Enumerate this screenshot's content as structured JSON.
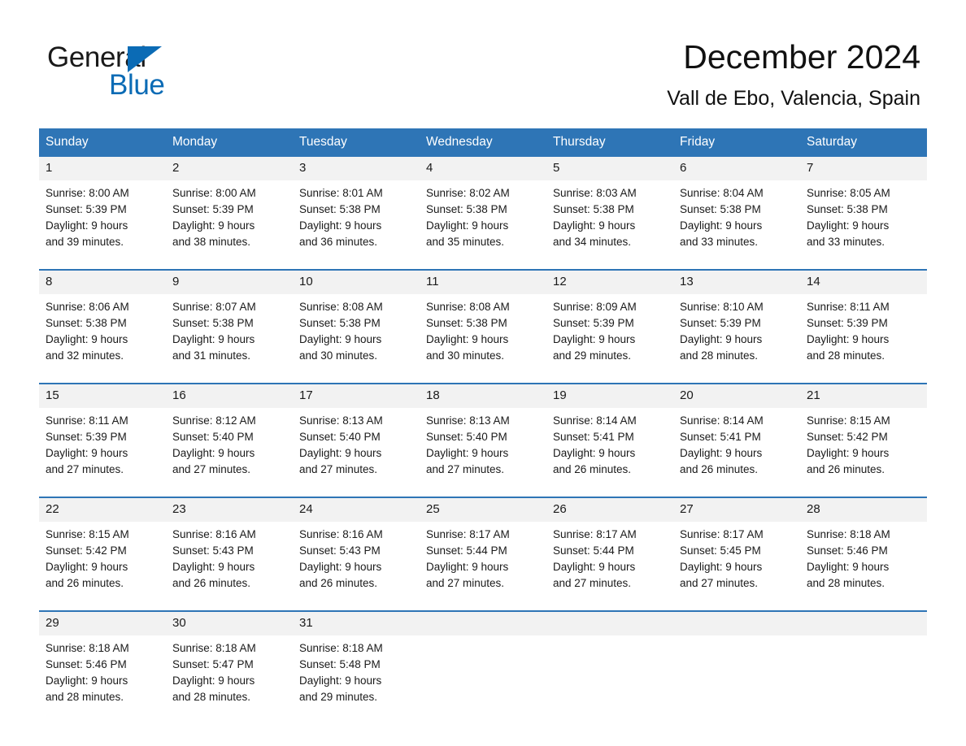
{
  "brand": {
    "name_part1": "General",
    "name_part2": "Blue",
    "accent_color": "#0b6bb5"
  },
  "header": {
    "month_title": "December 2024",
    "location": "Vall de Ebo, Valencia, Spain"
  },
  "theme": {
    "header_blue": "#2e75b6",
    "day_band_gray": "#f2f2f2",
    "text_color": "#1a1a1a"
  },
  "calendar": {
    "weekday_headers": [
      "Sunday",
      "Monday",
      "Tuesday",
      "Wednesday",
      "Thursday",
      "Friday",
      "Saturday"
    ],
    "weeks": [
      [
        {
          "date": "1",
          "sunrise": "Sunrise: 8:00 AM",
          "sunset": "Sunset: 5:39 PM",
          "daylight_line1": "Daylight: 9 hours",
          "daylight_line2": "and 39 minutes."
        },
        {
          "date": "2",
          "sunrise": "Sunrise: 8:00 AM",
          "sunset": "Sunset: 5:39 PM",
          "daylight_line1": "Daylight: 9 hours",
          "daylight_line2": "and 38 minutes."
        },
        {
          "date": "3",
          "sunrise": "Sunrise: 8:01 AM",
          "sunset": "Sunset: 5:38 PM",
          "daylight_line1": "Daylight: 9 hours",
          "daylight_line2": "and 36 minutes."
        },
        {
          "date": "4",
          "sunrise": "Sunrise: 8:02 AM",
          "sunset": "Sunset: 5:38 PM",
          "daylight_line1": "Daylight: 9 hours",
          "daylight_line2": "and 35 minutes."
        },
        {
          "date": "5",
          "sunrise": "Sunrise: 8:03 AM",
          "sunset": "Sunset: 5:38 PM",
          "daylight_line1": "Daylight: 9 hours",
          "daylight_line2": "and 34 minutes."
        },
        {
          "date": "6",
          "sunrise": "Sunrise: 8:04 AM",
          "sunset": "Sunset: 5:38 PM",
          "daylight_line1": "Daylight: 9 hours",
          "daylight_line2": "and 33 minutes."
        },
        {
          "date": "7",
          "sunrise": "Sunrise: 8:05 AM",
          "sunset": "Sunset: 5:38 PM",
          "daylight_line1": "Daylight: 9 hours",
          "daylight_line2": "and 33 minutes."
        }
      ],
      [
        {
          "date": "8",
          "sunrise": "Sunrise: 8:06 AM",
          "sunset": "Sunset: 5:38 PM",
          "daylight_line1": "Daylight: 9 hours",
          "daylight_line2": "and 32 minutes."
        },
        {
          "date": "9",
          "sunrise": "Sunrise: 8:07 AM",
          "sunset": "Sunset: 5:38 PM",
          "daylight_line1": "Daylight: 9 hours",
          "daylight_line2": "and 31 minutes."
        },
        {
          "date": "10",
          "sunrise": "Sunrise: 8:08 AM",
          "sunset": "Sunset: 5:38 PM",
          "daylight_line1": "Daylight: 9 hours",
          "daylight_line2": "and 30 minutes."
        },
        {
          "date": "11",
          "sunrise": "Sunrise: 8:08 AM",
          "sunset": "Sunset: 5:38 PM",
          "daylight_line1": "Daylight: 9 hours",
          "daylight_line2": "and 30 minutes."
        },
        {
          "date": "12",
          "sunrise": "Sunrise: 8:09 AM",
          "sunset": "Sunset: 5:39 PM",
          "daylight_line1": "Daylight: 9 hours",
          "daylight_line2": "and 29 minutes."
        },
        {
          "date": "13",
          "sunrise": "Sunrise: 8:10 AM",
          "sunset": "Sunset: 5:39 PM",
          "daylight_line1": "Daylight: 9 hours",
          "daylight_line2": "and 28 minutes."
        },
        {
          "date": "14",
          "sunrise": "Sunrise: 8:11 AM",
          "sunset": "Sunset: 5:39 PM",
          "daylight_line1": "Daylight: 9 hours",
          "daylight_line2": "and 28 minutes."
        }
      ],
      [
        {
          "date": "15",
          "sunrise": "Sunrise: 8:11 AM",
          "sunset": "Sunset: 5:39 PM",
          "daylight_line1": "Daylight: 9 hours",
          "daylight_line2": "and 27 minutes."
        },
        {
          "date": "16",
          "sunrise": "Sunrise: 8:12 AM",
          "sunset": "Sunset: 5:40 PM",
          "daylight_line1": "Daylight: 9 hours",
          "daylight_line2": "and 27 minutes."
        },
        {
          "date": "17",
          "sunrise": "Sunrise: 8:13 AM",
          "sunset": "Sunset: 5:40 PM",
          "daylight_line1": "Daylight: 9 hours",
          "daylight_line2": "and 27 minutes."
        },
        {
          "date": "18",
          "sunrise": "Sunrise: 8:13 AM",
          "sunset": "Sunset: 5:40 PM",
          "daylight_line1": "Daylight: 9 hours",
          "daylight_line2": "and 27 minutes."
        },
        {
          "date": "19",
          "sunrise": "Sunrise: 8:14 AM",
          "sunset": "Sunset: 5:41 PM",
          "daylight_line1": "Daylight: 9 hours",
          "daylight_line2": "and 26 minutes."
        },
        {
          "date": "20",
          "sunrise": "Sunrise: 8:14 AM",
          "sunset": "Sunset: 5:41 PM",
          "daylight_line1": "Daylight: 9 hours",
          "daylight_line2": "and 26 minutes."
        },
        {
          "date": "21",
          "sunrise": "Sunrise: 8:15 AM",
          "sunset": "Sunset: 5:42 PM",
          "daylight_line1": "Daylight: 9 hours",
          "daylight_line2": "and 26 minutes."
        }
      ],
      [
        {
          "date": "22",
          "sunrise": "Sunrise: 8:15 AM",
          "sunset": "Sunset: 5:42 PM",
          "daylight_line1": "Daylight: 9 hours",
          "daylight_line2": "and 26 minutes."
        },
        {
          "date": "23",
          "sunrise": "Sunrise: 8:16 AM",
          "sunset": "Sunset: 5:43 PM",
          "daylight_line1": "Daylight: 9 hours",
          "daylight_line2": "and 26 minutes."
        },
        {
          "date": "24",
          "sunrise": "Sunrise: 8:16 AM",
          "sunset": "Sunset: 5:43 PM",
          "daylight_line1": "Daylight: 9 hours",
          "daylight_line2": "and 26 minutes."
        },
        {
          "date": "25",
          "sunrise": "Sunrise: 8:17 AM",
          "sunset": "Sunset: 5:44 PM",
          "daylight_line1": "Daylight: 9 hours",
          "daylight_line2": "and 27 minutes."
        },
        {
          "date": "26",
          "sunrise": "Sunrise: 8:17 AM",
          "sunset": "Sunset: 5:44 PM",
          "daylight_line1": "Daylight: 9 hours",
          "daylight_line2": "and 27 minutes."
        },
        {
          "date": "27",
          "sunrise": "Sunrise: 8:17 AM",
          "sunset": "Sunset: 5:45 PM",
          "daylight_line1": "Daylight: 9 hours",
          "daylight_line2": "and 27 minutes."
        },
        {
          "date": "28",
          "sunrise": "Sunrise: 8:18 AM",
          "sunset": "Sunset: 5:46 PM",
          "daylight_line1": "Daylight: 9 hours",
          "daylight_line2": "and 28 minutes."
        }
      ],
      [
        {
          "date": "29",
          "sunrise": "Sunrise: 8:18 AM",
          "sunset": "Sunset: 5:46 PM",
          "daylight_line1": "Daylight: 9 hours",
          "daylight_line2": "and 28 minutes."
        },
        {
          "date": "30",
          "sunrise": "Sunrise: 8:18 AM",
          "sunset": "Sunset: 5:47 PM",
          "daylight_line1": "Daylight: 9 hours",
          "daylight_line2": "and 28 minutes."
        },
        {
          "date": "31",
          "sunrise": "Sunrise: 8:18 AM",
          "sunset": "Sunset: 5:48 PM",
          "daylight_line1": "Daylight: 9 hours",
          "daylight_line2": "and 29 minutes."
        },
        {
          "date": "",
          "sunrise": "",
          "sunset": "",
          "daylight_line1": "",
          "daylight_line2": ""
        },
        {
          "date": "",
          "sunrise": "",
          "sunset": "",
          "daylight_line1": "",
          "daylight_line2": ""
        },
        {
          "date": "",
          "sunrise": "",
          "sunset": "",
          "daylight_line1": "",
          "daylight_line2": ""
        },
        {
          "date": "",
          "sunrise": "",
          "sunset": "",
          "daylight_line1": "",
          "daylight_line2": ""
        }
      ]
    ]
  }
}
